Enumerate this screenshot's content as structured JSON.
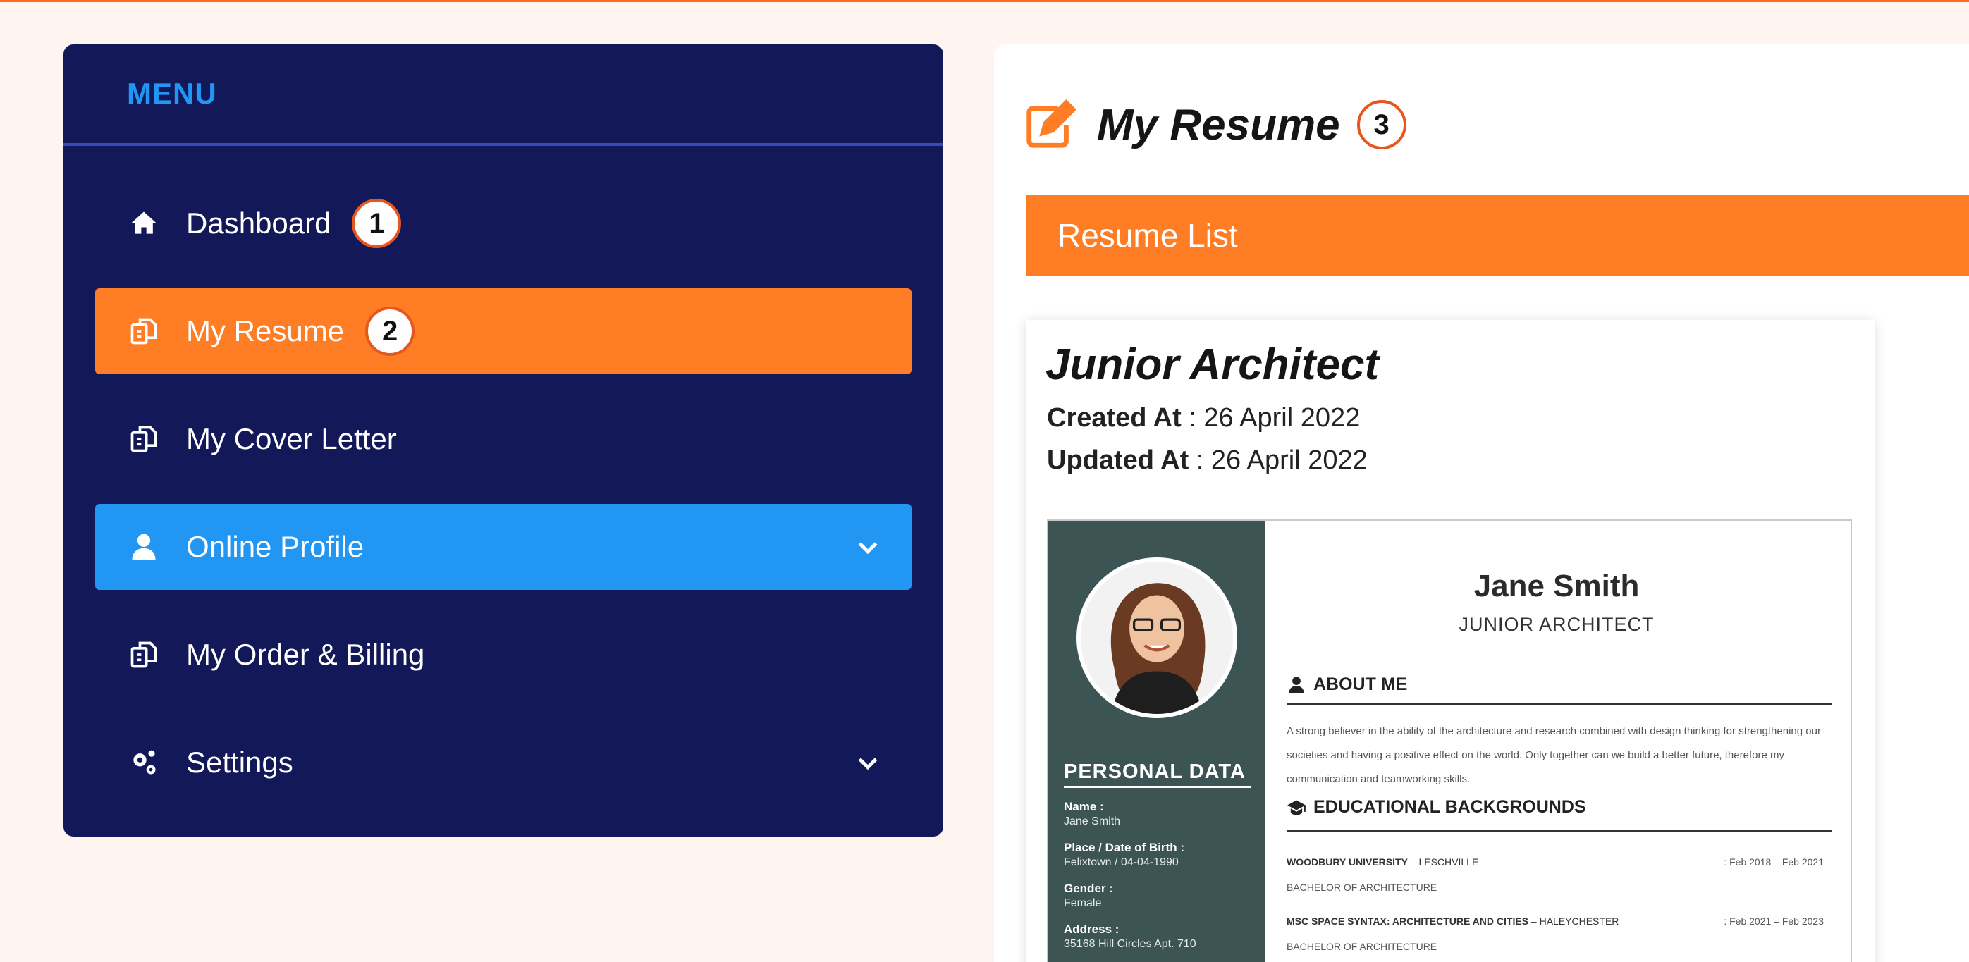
{
  "sidebar": {
    "title": "MENU",
    "items": [
      {
        "label": "Dashboard",
        "icon": "home-icon",
        "badge": "1"
      },
      {
        "label": "My Resume",
        "icon": "copy-icon",
        "badge": "2",
        "active": true
      },
      {
        "label": "My Cover Letter",
        "icon": "copy-icon"
      },
      {
        "label": "Online Profile",
        "icon": "user-icon",
        "expanded": true
      },
      {
        "label": "My Order & Billing",
        "icon": "copy-icon"
      },
      {
        "label": "Settings",
        "icon": "gears-icon"
      }
    ]
  },
  "main": {
    "title": "My Resume",
    "title_badge": "3",
    "list_header": "Resume List",
    "resume_card": {
      "title": "Junior Architect",
      "created_label": "Created At",
      "created_value": " : 26 April 2022",
      "updated_label": "Updated At",
      "updated_value": " : 26 April 2022"
    },
    "preview": {
      "name": "Jane Smith",
      "role": "JUNIOR ARCHITECT",
      "about_title": "ABOUT ME",
      "about_text": "A strong believer in the ability of the architecture and research combined with design thinking for strengthening our societies and having a positive effect on the world. Only together can we build a better future, therefore my communication and teamworking skills.",
      "edu_title": "EDUCATIONAL BACKGROUNDS",
      "education": [
        {
          "school": "WOODBURY UNIVERSITY",
          "city": " – LESCHVILLE",
          "dates": ":  Feb 2018 – Feb 2021",
          "degree": "BACHELOR OF ARCHITECTURE"
        },
        {
          "school": "MSC SPACE SYNTAX: ARCHITECTURE AND CITIES",
          "city": " – HALEYCHESTER",
          "dates": ":  Feb 2021 – Feb 2023",
          "degree": "BACHELOR OF ARCHITECTURE"
        }
      ],
      "personal_title": "PERSONAL DATA",
      "personal": [
        {
          "label": "Name :",
          "value": "Jane Smith"
        },
        {
          "label": "Place / Date of Birth :",
          "value": "Felixtown / 04-04-1990"
        },
        {
          "label": "Gender :",
          "value": "Female"
        },
        {
          "label": "Address :",
          "value": "35168 Hill Circles Apt. 710"
        }
      ]
    }
  },
  "colors": {
    "sidebar_bg": "#131858",
    "accent_orange": "#ff7d24",
    "accent_blue": "#2196f3",
    "page_bg": "#fff5f0"
  }
}
